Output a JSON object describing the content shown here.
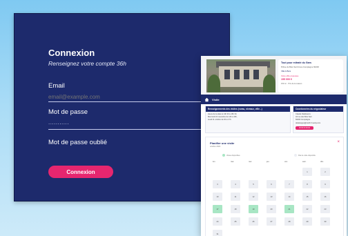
{
  "login": {
    "title": "Connexion",
    "subtitle": "Renseignez votre compte 36h",
    "email_label": "Email",
    "email_placeholder": "email@example.com",
    "password_label": "Mot de passe",
    "password_value": "...........",
    "forgot_label": "Mot de passe oublié",
    "submit_label": "Connexion"
  },
  "preview": {
    "listing": {
      "title": "Tout pour mitraté du Gars",
      "address": "8 Rue du Bois Sart bruxe Compiègne 60200",
      "sub": "Villa & Bois",
      "tag": "Votre offre proposée",
      "price": "155 000 €",
      "meta": "150 m² · Prix de la maison"
    },
    "visite_label": "Visite",
    "requirements": {
      "title": "Renseignements des visites (rueau, niveaux, ville...)",
      "lines": [
        "Heure de la date le 14h 30 à 16h 30,",
        "Mercredi 10 novembre de 14h à 16h,",
        "Jeudi 11 octobre de 9h à 17h."
      ]
    },
    "contact": {
      "title": "Coordonnées du négociateur",
      "lines": [
        "Claude Delahuerre",
        "42 rue des Bois Sart",
        "60200 Compiègne",
        "",
        "delaranges@ns2d.fr.nexity.com"
      ],
      "button": "06 00 00 00 00"
    },
    "planner": {
      "title": "Planifier une visite",
      "subtitle": "octobre 2022",
      "close": "×",
      "legend": [
        "Visites disponibles",
        "Pas de visite disponible"
      ],
      "weekdays": [
        "lun.",
        "mar.",
        "mer.",
        "jeu.",
        "ven.",
        "sam.",
        "dim."
      ],
      "days": [
        "1",
        "2",
        "3",
        "4",
        "5",
        "6",
        "7",
        "8",
        "9",
        "10",
        "11",
        "12",
        "13",
        "14",
        "15",
        "16",
        "17",
        "18",
        "19",
        "20",
        "21",
        "22",
        "23",
        "24",
        "25",
        "26",
        "27",
        "28",
        "29",
        "30",
        "31"
      ],
      "available_days": [
        "17",
        "19",
        "21"
      ]
    }
  },
  "colors": {
    "navy": "#1d2a6c",
    "accent": "#e6266f",
    "available": "#a8e6c4",
    "background": "#aadcf6"
  }
}
